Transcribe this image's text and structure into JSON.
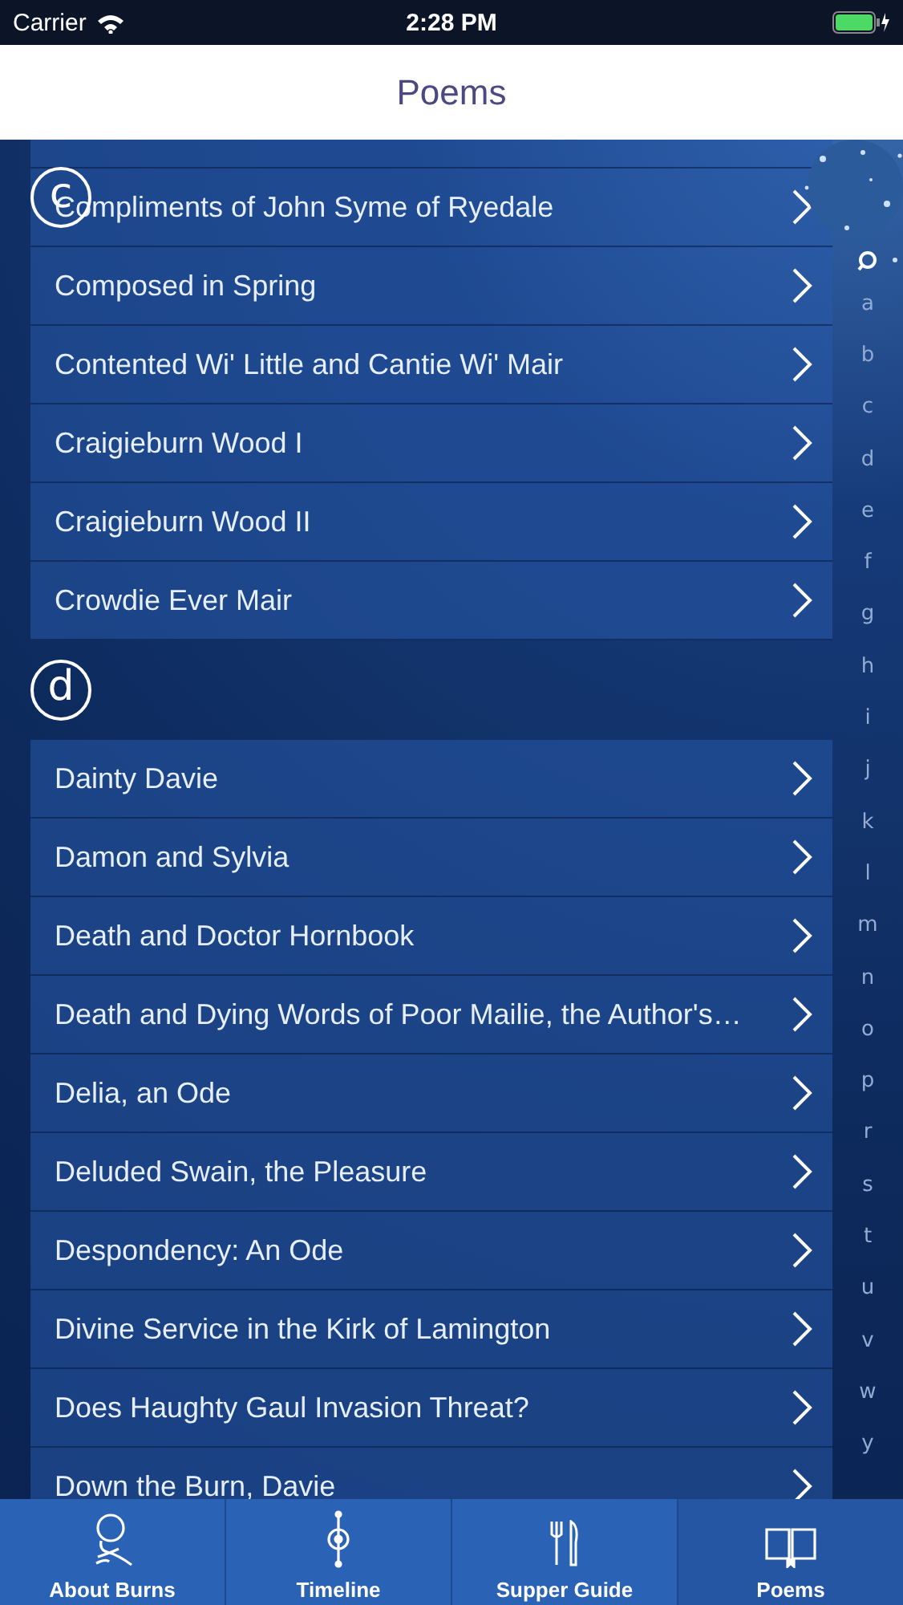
{
  "status_bar": {
    "carrier": "Carrier",
    "time": "2:28 PM"
  },
  "nav": {
    "title": "Poems"
  },
  "sections": [
    {
      "letter": "c",
      "kind": "floating",
      "rows": [
        "Compliments of John Syme of Ryedale",
        "Composed in Spring",
        "Contented Wi' Little and Cantie Wi' Mair",
        "Craigieburn Wood I",
        "Craigieburn Wood II",
        "Crowdie Ever Mair"
      ]
    },
    {
      "letter": "d",
      "kind": "inline",
      "rows": [
        "Dainty Davie",
        "Damon and Sylvia",
        "Death and Doctor Hornbook",
        "Death and Dying Words of Poor Mailie, the Author's…",
        "Delia, an Ode",
        "Deluded Swain, the Pleasure",
        "Despondency: An Ode",
        "Divine Service in the Kirk of Lamington",
        "Does Haughty Gaul Invasion Threat?",
        "Down the Burn, Davie"
      ]
    }
  ],
  "index": [
    "a",
    "b",
    "c",
    "d",
    "e",
    "f",
    "g",
    "h",
    "i",
    "j",
    "k",
    "l",
    "m",
    "n",
    "o",
    "p",
    "r",
    "s",
    "t",
    "u",
    "v",
    "w",
    "y"
  ],
  "tabs": [
    {
      "label": "About Burns",
      "selected": false
    },
    {
      "label": "Timeline",
      "selected": false
    },
    {
      "label": "Supper Guide",
      "selected": false
    },
    {
      "label": "Poems",
      "selected": true
    }
  ]
}
